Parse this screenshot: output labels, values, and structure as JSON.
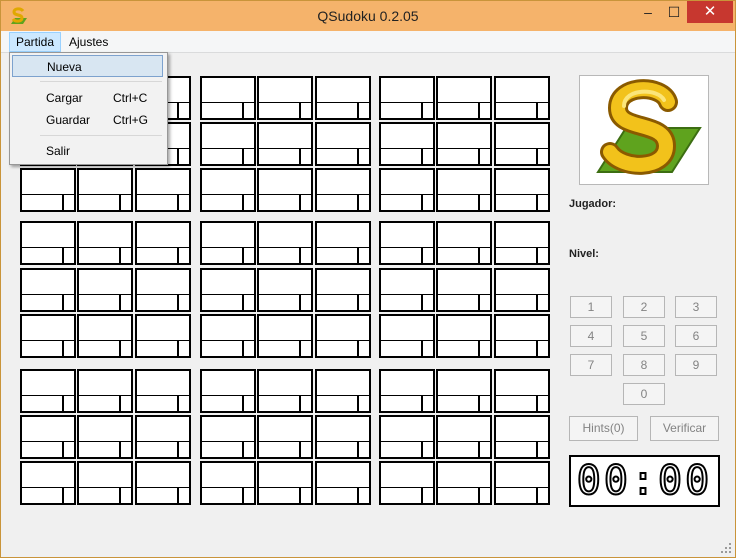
{
  "window": {
    "title": "QSudoku 0.2.05",
    "controls": {
      "minimize": "–",
      "maximize": "☐",
      "close": "✕"
    }
  },
  "menubar": {
    "items": [
      "Partida",
      "Ajustes"
    ]
  },
  "dropdown": {
    "items": [
      {
        "label": "Nueva",
        "shortcut": ""
      },
      {
        "label": "Cargar",
        "shortcut": "Ctrl+C"
      },
      {
        "label": "Guardar",
        "shortcut": "Ctrl+G"
      },
      {
        "label": "Salir",
        "shortcut": ""
      }
    ]
  },
  "board": {
    "rows": 9,
    "cols": 9,
    "cells": [
      "",
      "",
      "",
      "",
      "",
      "",
      "",
      "",
      "",
      "",
      "",
      "",
      "",
      "",
      "",
      "",
      "",
      "",
      "",
      "",
      "",
      "",
      "",
      "",
      "",
      "",
      "",
      "",
      "",
      "",
      "",
      "",
      "",
      "",
      "",
      "",
      "",
      "",
      "",
      "",
      "",
      "",
      "",
      "",
      "",
      "",
      "",
      "",
      "",
      "",
      "",
      "",
      "",
      "",
      "",
      "",
      "",
      "",
      "",
      "",
      "",
      "",
      "",
      "",
      "",
      "",
      "",
      "",
      "",
      "",
      "",
      "",
      "",
      "",
      "",
      "",
      "",
      "",
      "",
      "",
      ""
    ]
  },
  "side": {
    "jugador_label": "Jugador:",
    "nivel_label": "Nivel:",
    "number_buttons": [
      "1",
      "2",
      "3",
      "4",
      "5",
      "6",
      "7",
      "8",
      "9",
      "0"
    ],
    "hints_label": "Hints(0)",
    "verificar_label": "Verificar",
    "timer": "00:00"
  },
  "colors": {
    "titlebar": "#f5b36b",
    "close_button": "#c7372f",
    "menu_highlight": "#cce8ff",
    "logo_yellow": "#f2c21b",
    "logo_green": "#5fa31e"
  },
  "icons": {
    "app": "qsudoku-s-icon",
    "logo": "qsudoku-s-logo"
  }
}
